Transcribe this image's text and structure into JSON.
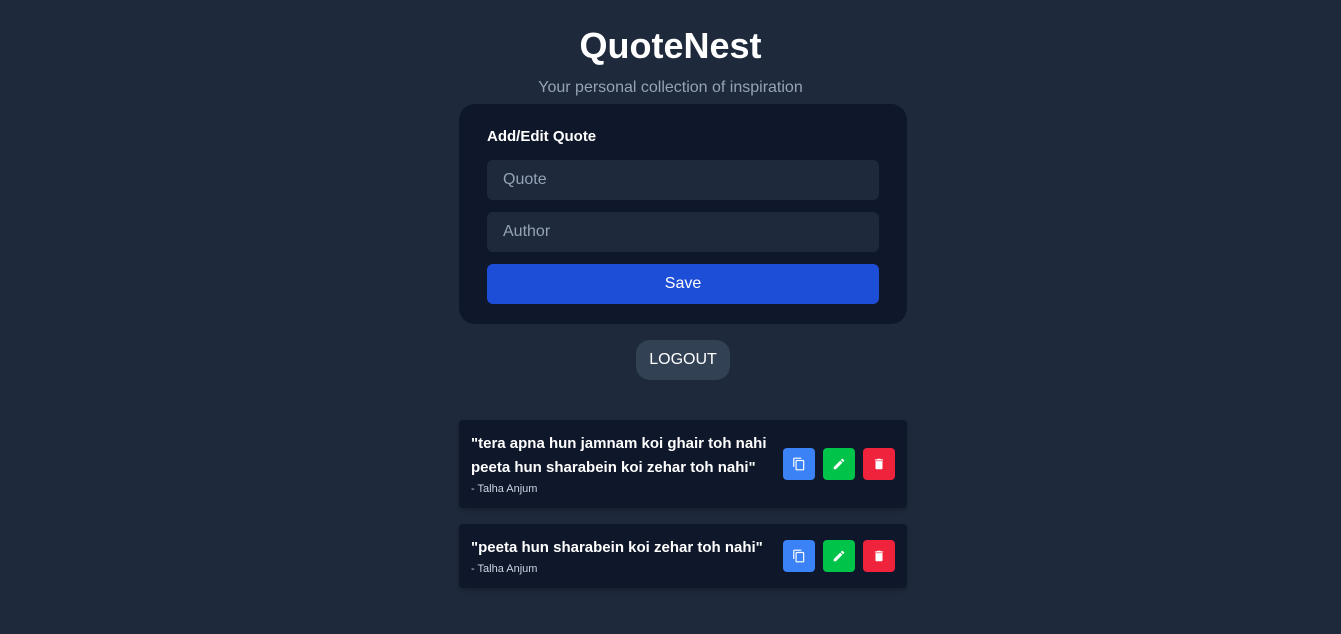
{
  "header": {
    "title": "QuoteNest",
    "subtitle": "Your personal collection of inspiration"
  },
  "form": {
    "heading": "Add/Edit Quote",
    "quote_placeholder": "Quote",
    "quote_value": "",
    "author_placeholder": "Author",
    "author_value": "",
    "save_label": "Save"
  },
  "logout_label": "LOGOUT",
  "quotes": [
    {
      "text": "\"tera apna hun jamnam koi ghair toh nahi peeta hun sharabein koi zehar toh nahi\"",
      "author": "- Talha Anjum"
    },
    {
      "text": "\"peeta hun sharabein koi zehar toh nahi\"",
      "author": "- Talha Anjum"
    }
  ],
  "icons": {
    "copy": "copy-icon",
    "edit": "pencil-icon",
    "delete": "trash-icon"
  },
  "colors": {
    "background": "#1e293b",
    "card": "#0f172a",
    "save": "#1d4ed8",
    "copy": "#3b82f6",
    "edit": "#00c34a",
    "delete": "#ef233c"
  }
}
